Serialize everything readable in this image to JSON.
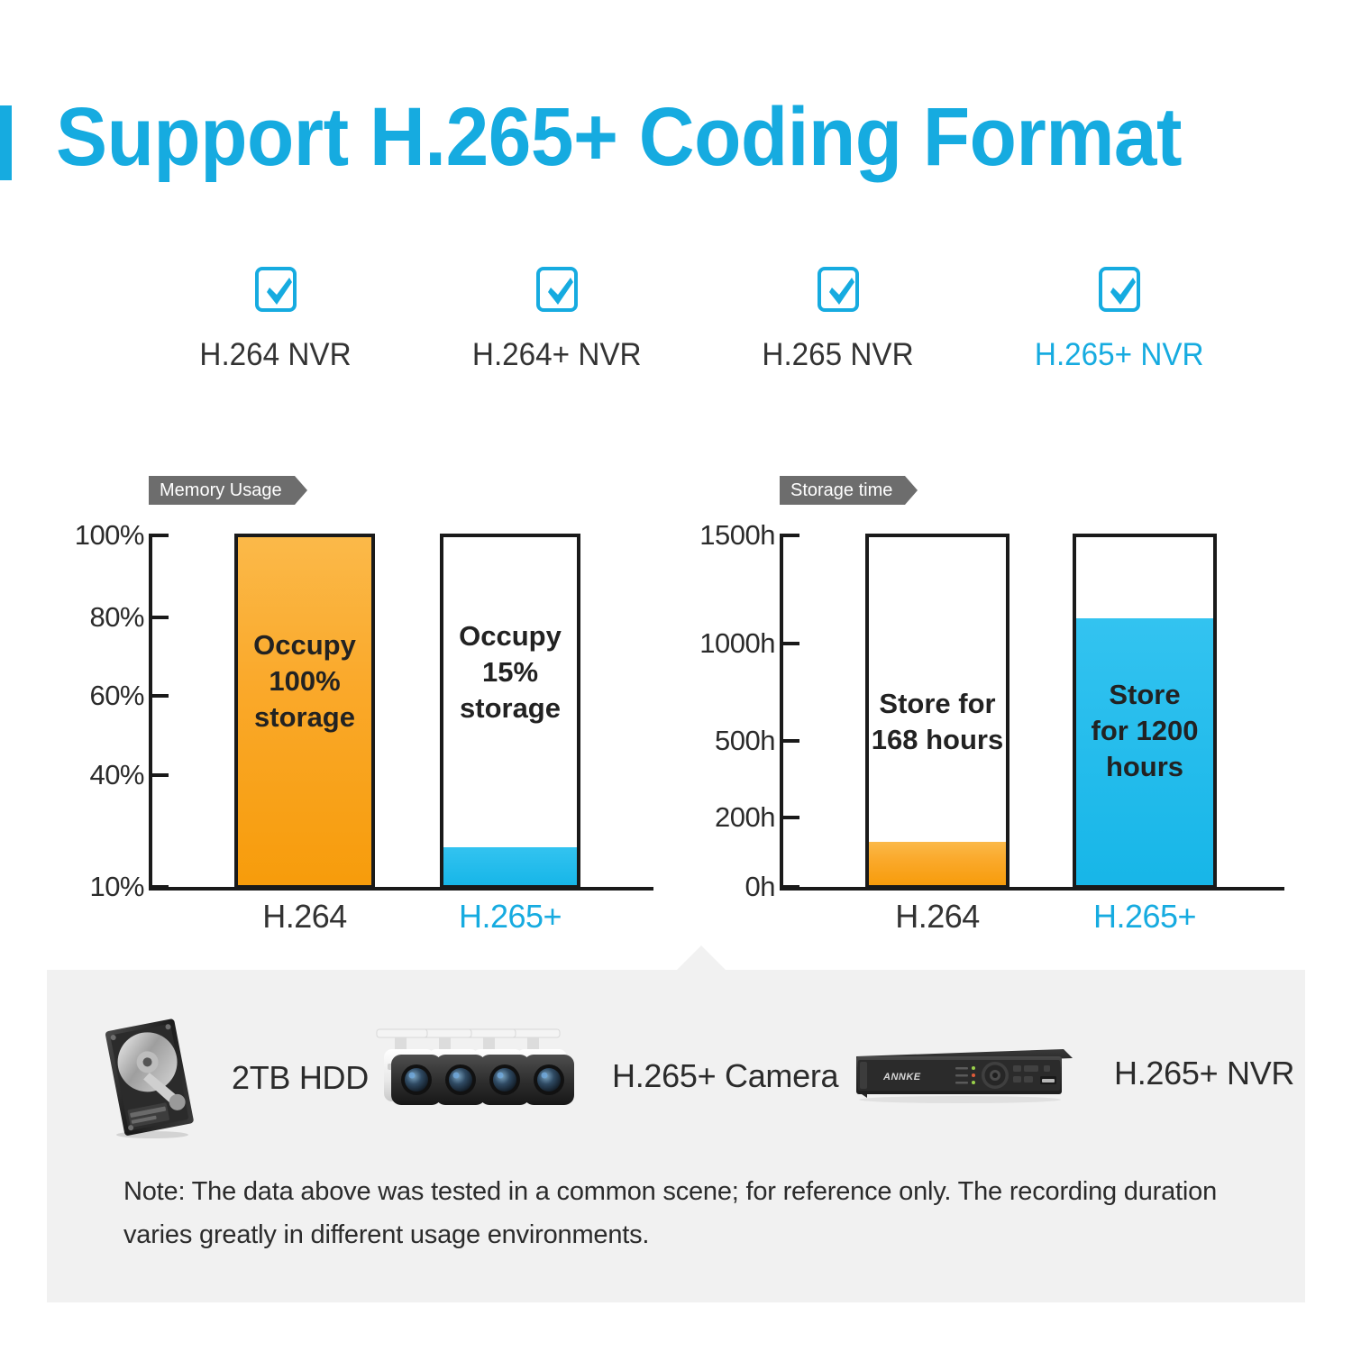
{
  "title": "Support H.265+ Coding Format",
  "accent_color": "#16ABE0",
  "orange_color": "#F9A11B",
  "checklist": [
    {
      "label": "H.264 NVR",
      "icon": "check-icon",
      "highlight": false
    },
    {
      "label": "H.264+ NVR",
      "icon": "check-icon",
      "highlight": false
    },
    {
      "label": "H.265 NVR",
      "icon": "check-icon",
      "highlight": false
    },
    {
      "label": "H.265+ NVR",
      "icon": "check-icon",
      "highlight": true
    }
  ],
  "chart_data": [
    {
      "type": "bar",
      "title": "Memory Usage",
      "xlabel": "",
      "ylabel": "",
      "categories": [
        "H.264",
        "H.265+"
      ],
      "values": [
        100,
        15
      ],
      "value_labels": [
        "Occupy\n100%\nstorage",
        "Occupy\n15%\nstorage"
      ],
      "bar_texts": [
        [
          "Occupy",
          "100%",
          "storage"
        ],
        [
          "Occupy",
          "15%",
          "storage"
        ]
      ],
      "colors": [
        "#F9A11B",
        "#21BCEC"
      ],
      "ylim": [
        0,
        100
      ],
      "ytick_values": [
        10,
        40,
        60,
        80,
        100
      ],
      "ytick_labels": [
        "10%",
        "40%",
        "60%",
        "80%",
        "100%"
      ],
      "grid": false,
      "legend": "none",
      "highlight_category": "H.265+"
    },
    {
      "type": "bar",
      "title": "Storage time",
      "xlabel": "",
      "ylabel": "",
      "categories": [
        "H.264",
        "H.265+"
      ],
      "values": [
        168,
        1200
      ],
      "value_labels": [
        "Store for 168 hours",
        "Store for 1200 hours"
      ],
      "bar_texts": [
        [
          "Store for",
          "168 hours"
        ],
        [
          "Store",
          "for 1200",
          "hours"
        ]
      ],
      "colors": [
        "#F9A11B",
        "#21BCEC"
      ],
      "ylim": [
        0,
        1500
      ],
      "ytick_values": [
        0,
        200,
        500,
        1000,
        1500
      ],
      "ytick_labels": [
        "0h",
        "200h",
        "500h",
        "1000h",
        "1500h"
      ],
      "grid": false,
      "legend": "none",
      "highlight_category": "H.265+"
    }
  ],
  "products": [
    {
      "label": "2TB HDD",
      "icon": "hard-drive-icon"
    },
    {
      "label": "H.265+ Camera",
      "icon": "bullet-camera-group-icon"
    },
    {
      "label": "H.265+ NVR",
      "icon": "nvr-recorder-icon",
      "brand": "ANNKE"
    }
  ],
  "note": "Note: The data above was tested in a common scene; for reference only. The recording duration varies greatly in different usage environments."
}
